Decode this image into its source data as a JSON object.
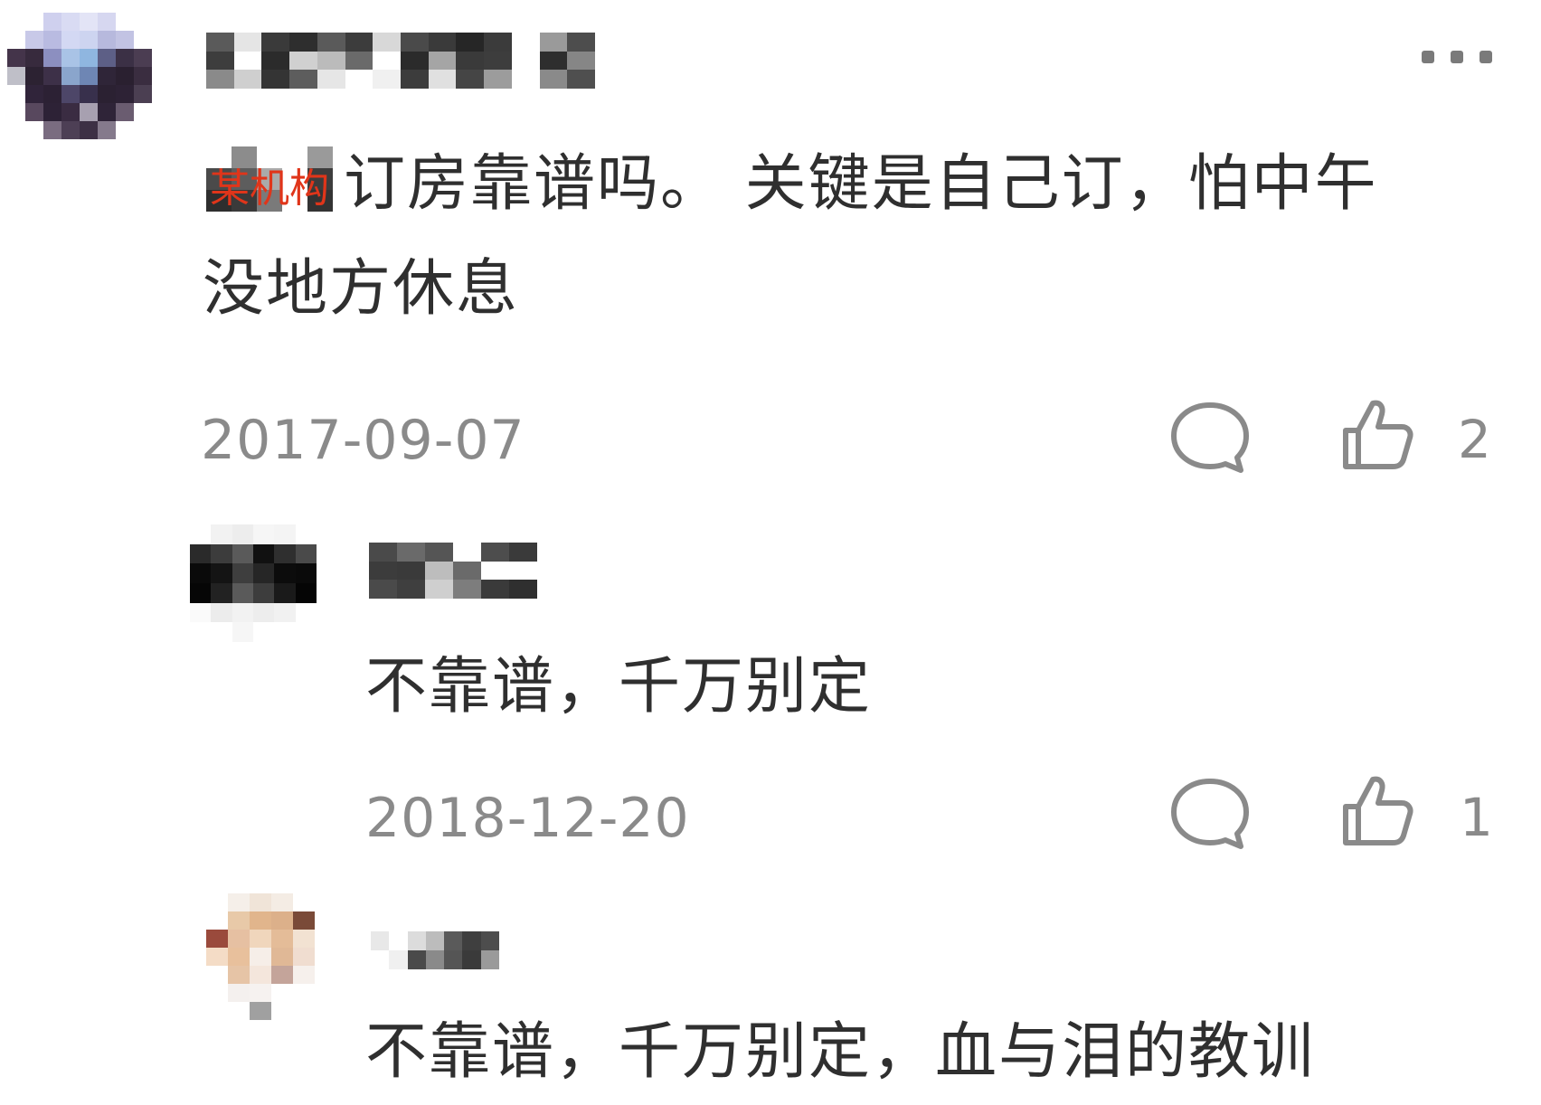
{
  "colors": {
    "text": "#2f2f2f",
    "meta": "#8a8a8a",
    "watermark": "#e0351a",
    "background": "#ffffff"
  },
  "comment": {
    "watermark": "某机构",
    "text_line1": "订房靠谱吗。 关键是自己订，怕中午",
    "text_line2": "没地方休息",
    "date": "2017-09-07",
    "likes": "2",
    "icons": [
      "more-icon",
      "reply-icon",
      "thumbs-up-icon"
    ]
  },
  "replies": [
    {
      "text": "不靠谱，千万别定",
      "date": "2018-12-20",
      "likes": "1"
    },
    {
      "text": "不靠谱，千万别定，血与泪的教训"
    }
  ]
}
